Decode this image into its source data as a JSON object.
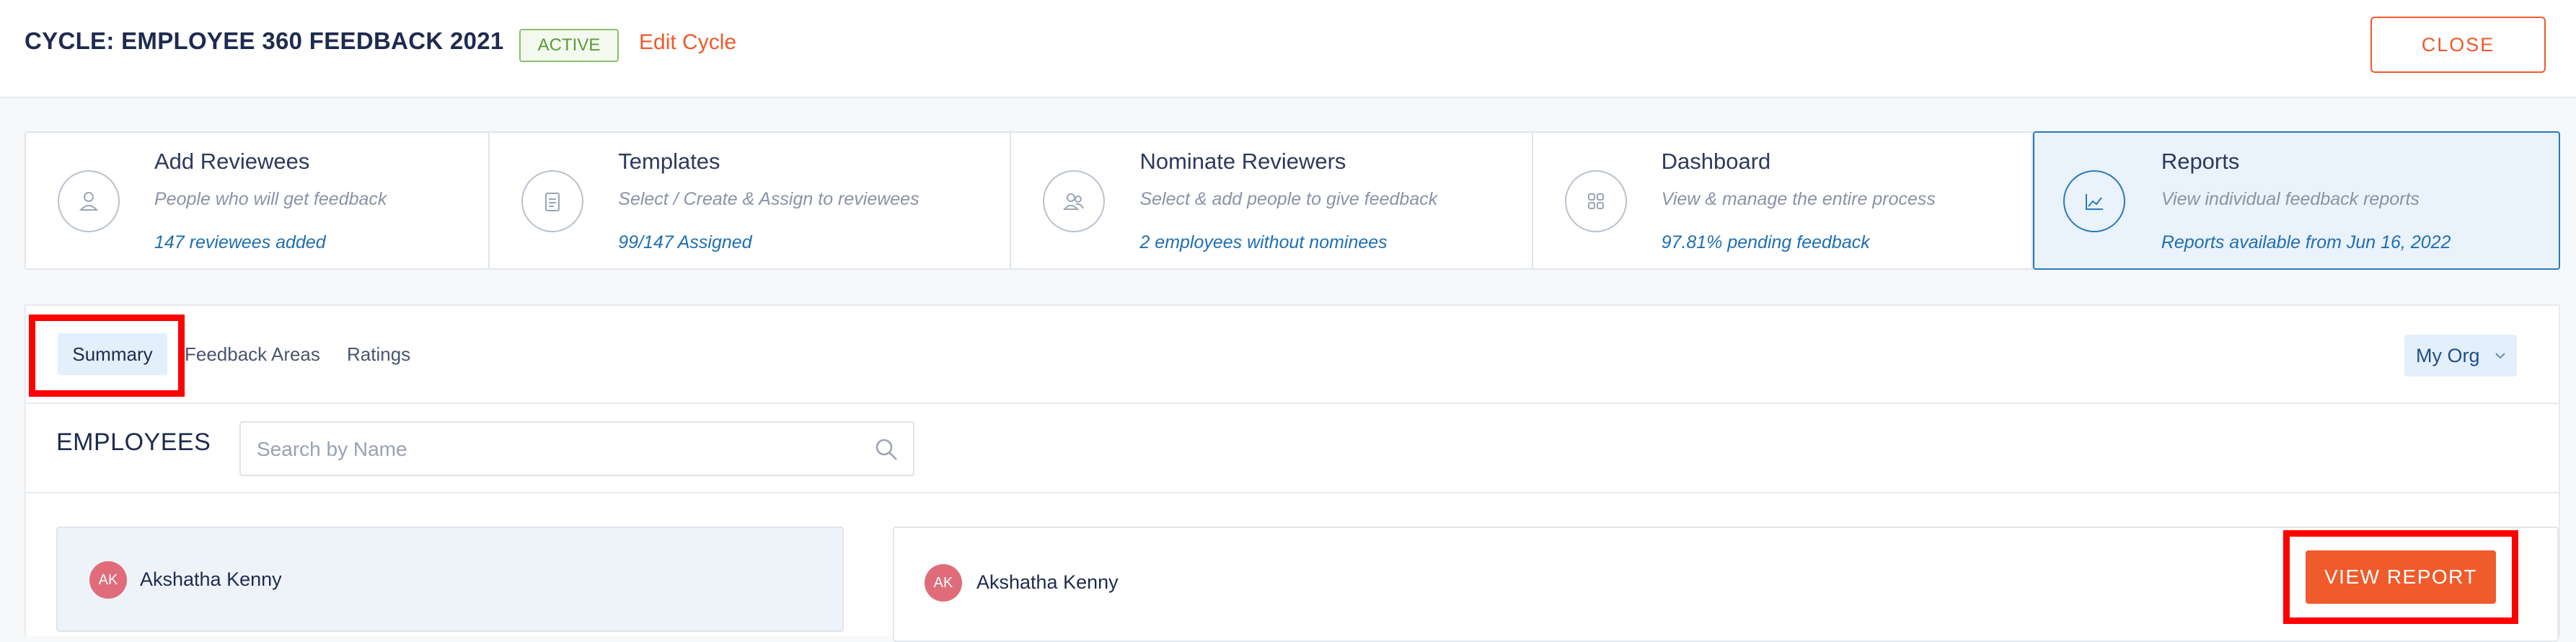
{
  "header": {
    "cycle_title": "CYCLE: EMPLOYEE 360 FEEDBACK 2021",
    "status": "ACTIVE",
    "edit_label": "Edit Cycle",
    "close_label": "CLOSE"
  },
  "steps": [
    {
      "title": "Add Reviewees",
      "desc": "People who will get feedback",
      "meta": "147  reviewees added",
      "icon": "person-icon"
    },
    {
      "title": "Templates",
      "desc": "Select / Create & Assign to reviewees",
      "meta": "99/147  Assigned",
      "icon": "clipboard-icon"
    },
    {
      "title": "Nominate Reviewers",
      "desc": "Select & add people to give feedback",
      "meta": "2  employees without nominees",
      "icon": "people-icon"
    },
    {
      "title": "Dashboard",
      "desc": "View & manage the entire process",
      "meta": "97.81% pending feedback",
      "icon": "grid-icon"
    },
    {
      "title": "Reports",
      "desc": "View individual feedback reports",
      "meta": "Reports available from Jun 16, 2022",
      "icon": "chart-icon"
    }
  ],
  "tabs": {
    "summary": "Summary",
    "feedback_areas": "Feedback Areas",
    "ratings": "Ratings",
    "org_select": "My Org"
  },
  "employees": {
    "title": "EMPLOYEES",
    "search_placeholder": "Search by Name",
    "list": [
      {
        "initials": "AK",
        "name": "Akshatha Kenny"
      }
    ],
    "selected": {
      "initials": "AK",
      "name": "Akshatha Kenny"
    },
    "view_report_label": "VIEW REPORT"
  },
  "colors": {
    "accent": "#f0592b",
    "active_green": "#5a9a3b",
    "link_blue": "#1f6fb0",
    "highlight_red": "#ff0000",
    "avatar": "#e06c7a"
  }
}
